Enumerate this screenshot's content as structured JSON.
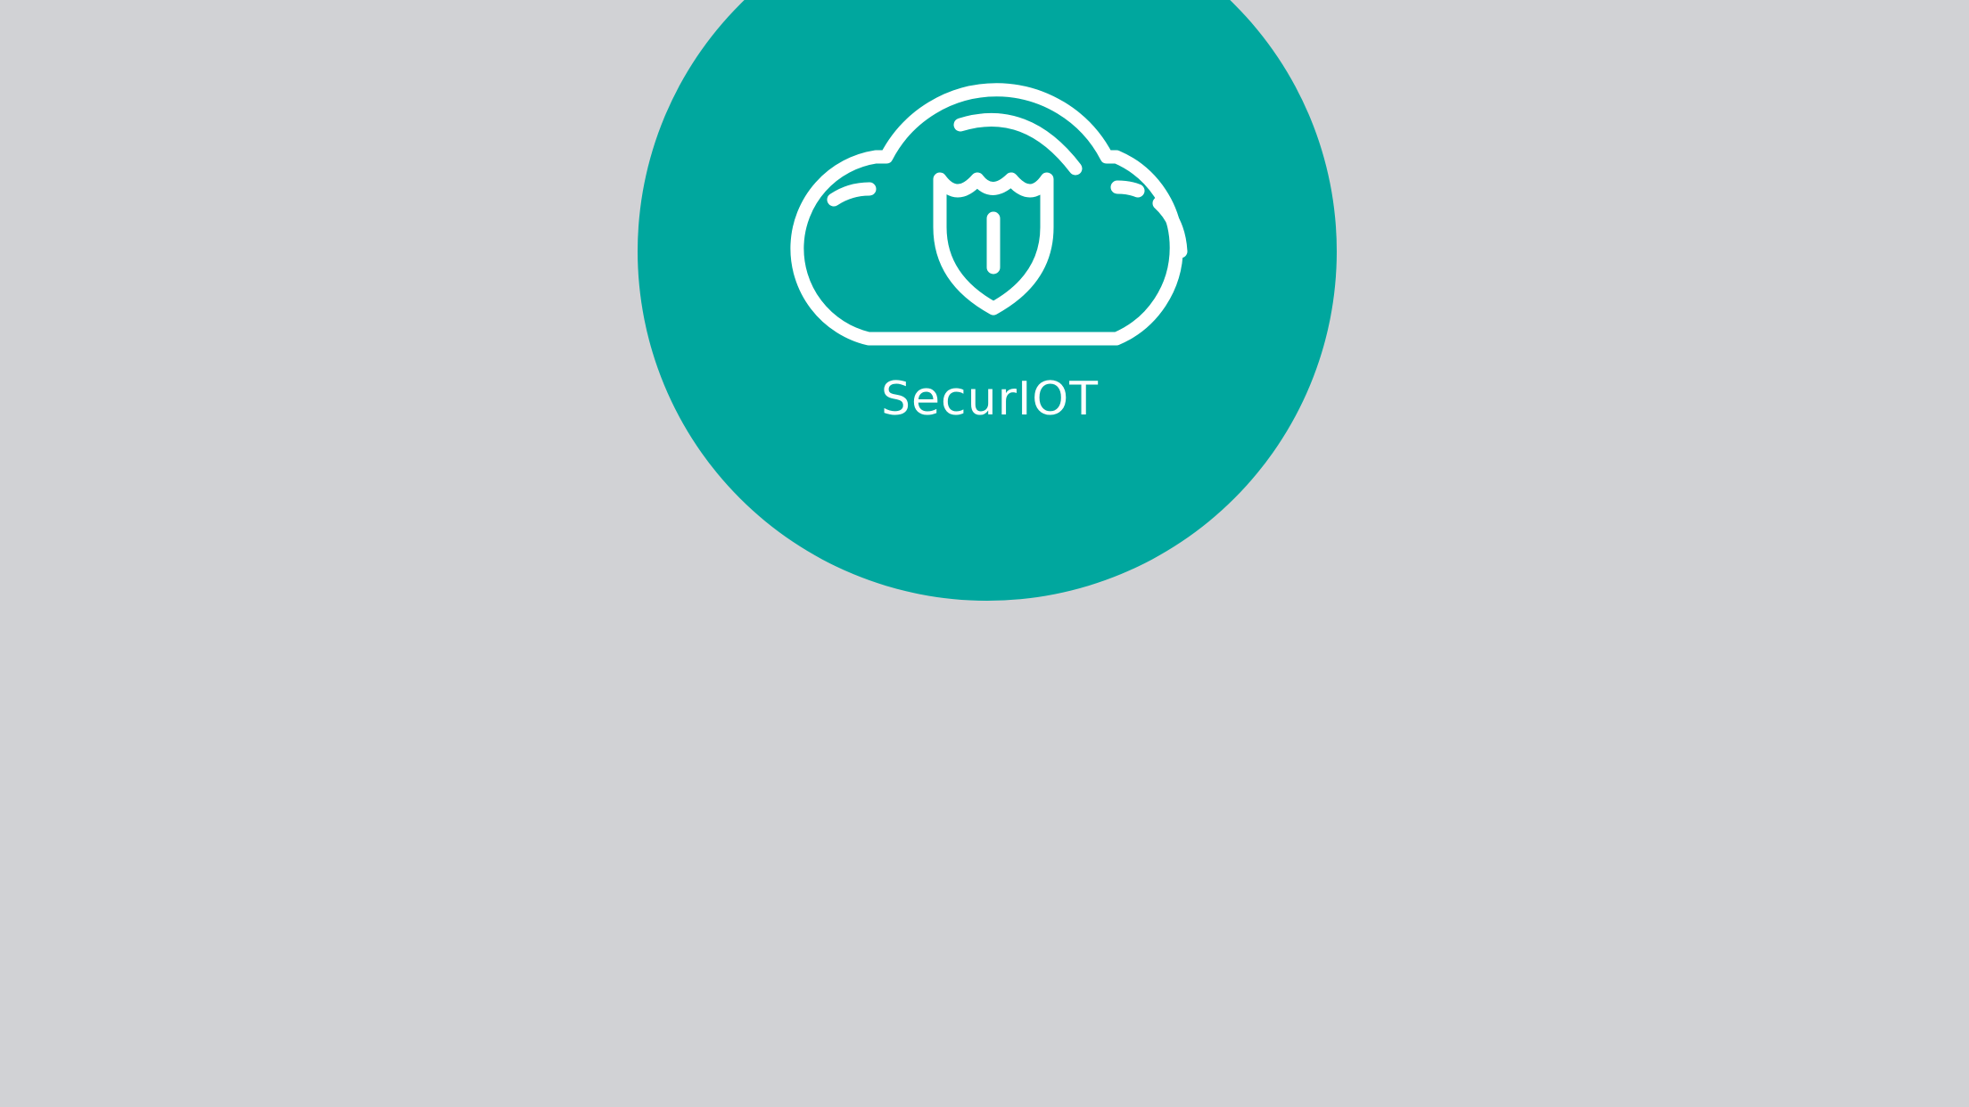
{
  "app": {
    "brand_name": "SecurIOT",
    "logo_icon": "cloud-shield-icon"
  },
  "colors": {
    "background": "#d1d2d5",
    "accent": "#00a79e",
    "foreground": "#ffffff"
  }
}
